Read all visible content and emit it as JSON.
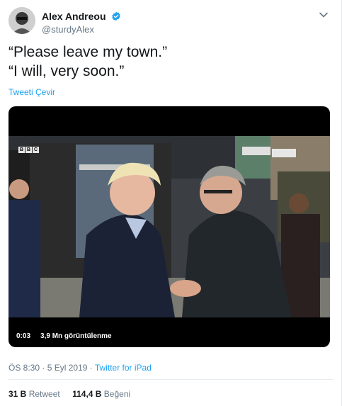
{
  "tweet": {
    "author": {
      "display_name": "Alex Andreou",
      "handle": "@sturdyAlex",
      "verified": true
    },
    "lines": [
      "“Please leave my town.”",
      "“I will, very soon.”"
    ],
    "translate_label": "Tweeti Çevir",
    "video": {
      "channel_logo": "BBC",
      "duration": "0:03",
      "views": "3,9 Mn görüntülenme"
    },
    "time": "ÖS 8:30",
    "separator1": " · ",
    "date": "5 Eyl 2019",
    "separator2": " · ",
    "source": "Twitter for iPad",
    "retweets": {
      "count": "31 B",
      "label": "Retweet"
    },
    "likes": {
      "count": "114,4 B",
      "label": "Beğeni"
    }
  },
  "colors": {
    "accent": "#1da1f2",
    "secondary_text": "#657786",
    "primary_text": "#14171a",
    "divider": "#e6ecf0"
  },
  "icons": {
    "verified": "verified-badge-icon",
    "caret": "chevron-down-icon"
  }
}
